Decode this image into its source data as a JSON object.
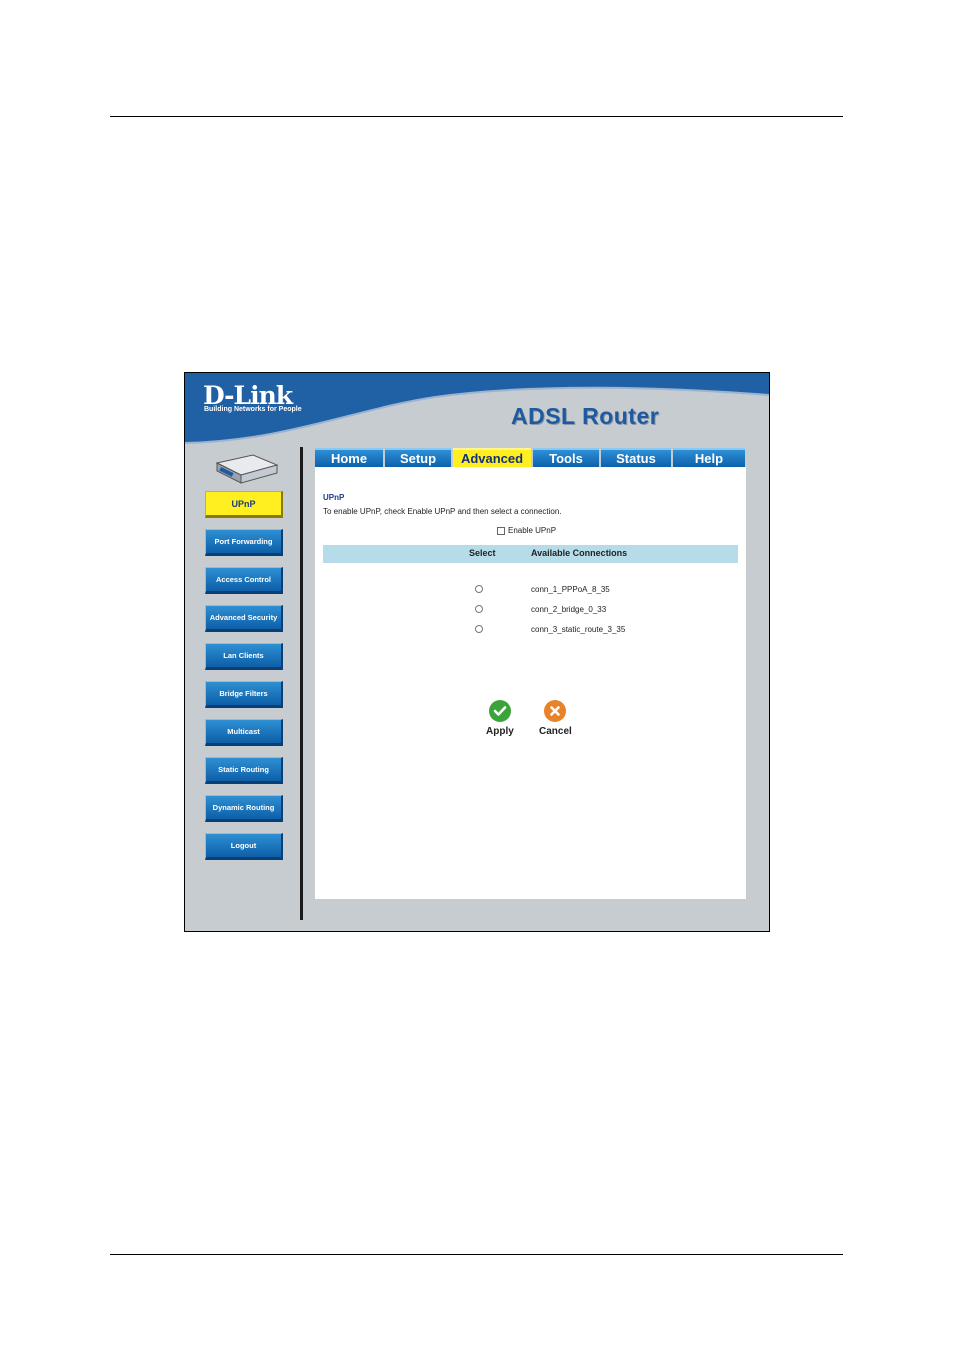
{
  "header": {
    "logo": "D-Link",
    "logo_tagline": "Building Networks for People",
    "product": "ADSL Router"
  },
  "tabs": [
    {
      "label": "Home",
      "active": false
    },
    {
      "label": "Setup",
      "active": false
    },
    {
      "label": "Advanced",
      "active": true
    },
    {
      "label": "Tools",
      "active": false
    },
    {
      "label": "Status",
      "active": false
    },
    {
      "label": "Help",
      "active": false
    }
  ],
  "sidebar": {
    "items": [
      {
        "label": "UPnP",
        "active": true
      },
      {
        "label": "Port Forwarding",
        "active": false
      },
      {
        "label": "Access Control",
        "active": false
      },
      {
        "label": "Advanced Security",
        "active": false
      },
      {
        "label": "Lan Clients",
        "active": false
      },
      {
        "label": "Bridge Filters",
        "active": false
      },
      {
        "label": "Multicast",
        "active": false
      },
      {
        "label": "Static Routing",
        "active": false
      },
      {
        "label": "Dynamic Routing",
        "active": false
      },
      {
        "label": "Logout",
        "active": false
      }
    ]
  },
  "main": {
    "title": "UPnP",
    "description": "To enable UPnP, check Enable UPnP and then select a connection.",
    "enable_label": "Enable UPnP",
    "enable_checked": false,
    "table": {
      "headers": [
        "Select",
        "Available Connections"
      ],
      "rows": [
        {
          "connection": "conn_1_PPPoA_8_35",
          "selected": false
        },
        {
          "connection": "conn_2_bridge_0_33",
          "selected": false
        },
        {
          "connection": "conn_3_static_route_3_35",
          "selected": false
        }
      ]
    },
    "apply_label": "Apply",
    "cancel_label": "Cancel"
  },
  "colors": {
    "accent_blue": "#1f5aa0",
    "active_yellow": "#ffee20",
    "table_header": "#b6dcea",
    "apply_green": "#3aa33a",
    "cancel_orange": "#e8832a"
  },
  "icons": {
    "apply": "check-icon",
    "cancel": "x-icon",
    "device": "router-device-icon"
  }
}
